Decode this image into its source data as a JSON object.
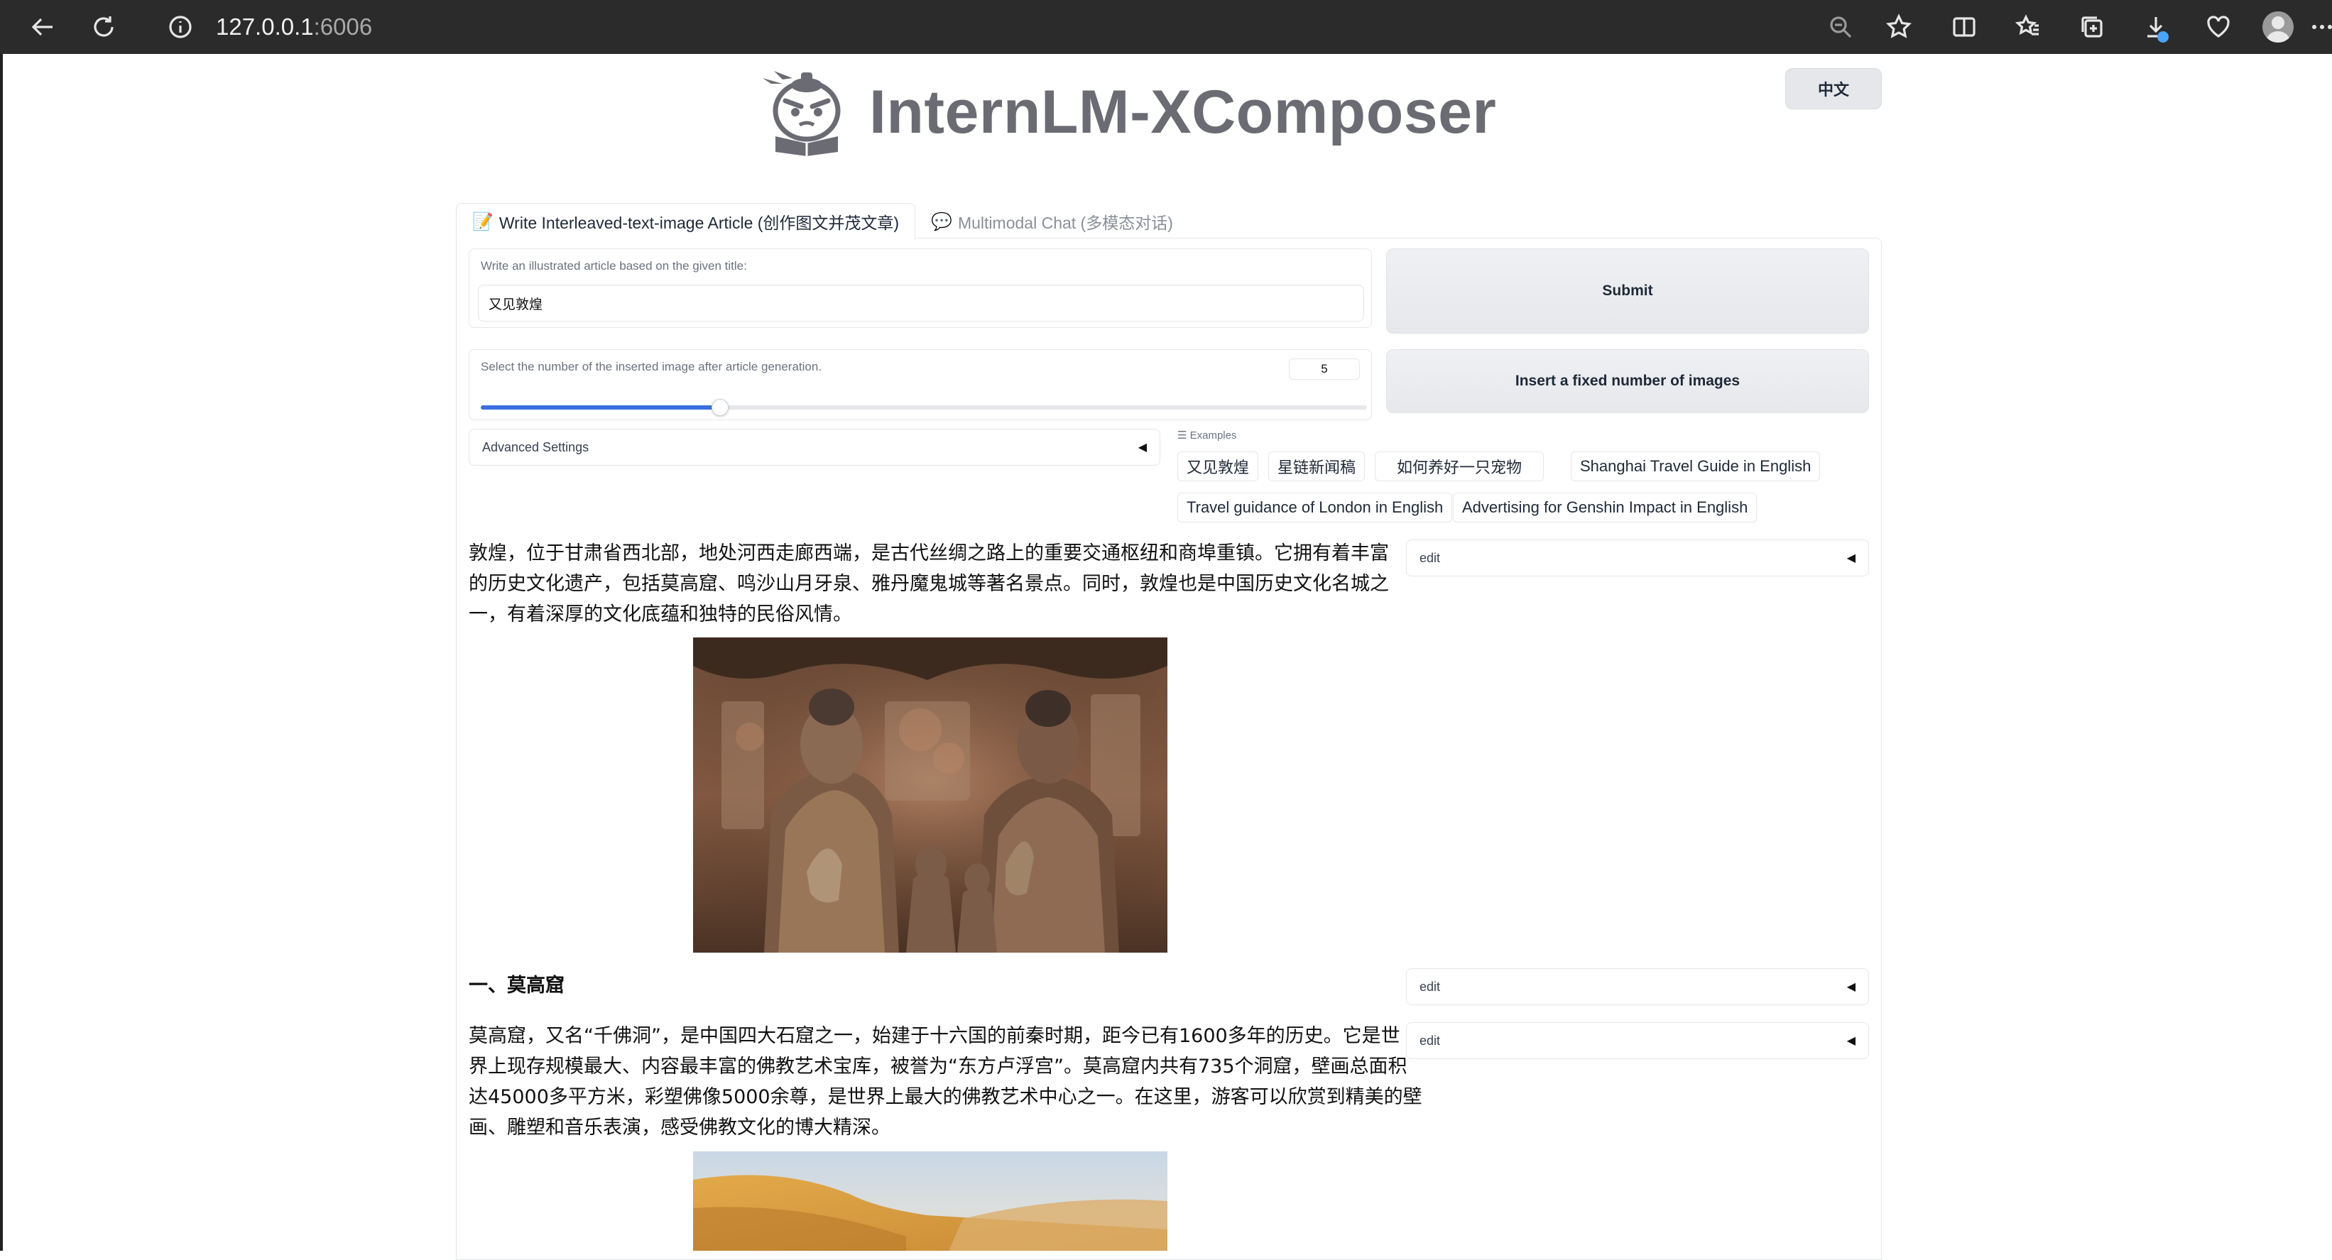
{
  "browser": {
    "url_host": "127.0.0.1",
    "url_port": ":6006"
  },
  "header": {
    "language_button": "中文",
    "app_title": "InternLM-XComposer"
  },
  "tabs": [
    {
      "emoji": "📝",
      "label": "Write Interleaved-text-image Article (创作图文并茂文章)"
    },
    {
      "emoji": "💬",
      "label": "Multimodal Chat (多模态对话)"
    }
  ],
  "form": {
    "title_label": "Write an illustrated article based on the given title:",
    "title_value": "又见敦煌",
    "image_count_label": "Select the number of the inserted image after article generation.",
    "image_count_value": "5",
    "image_count_fraction": 0.27,
    "advanced_settings_label": "Advanced Settings",
    "submit_label": "Submit",
    "insert_label": "Insert a fixed number of images"
  },
  "examples": {
    "label": "Examples",
    "items": [
      "又见敦煌",
      "星链新闻稿",
      "如何养好一只宠物",
      "Shanghai Travel Guide in English",
      "Travel guidance of London in English",
      "Advertising for Genshin Impact in English"
    ]
  },
  "article": {
    "paragraph1": [
      "敦煌，位于甘肃省西北部，地处河西走廊西端，是古代丝绸之路上的重要交通枢纽和商埠重镇。它拥有着丰富",
      "的历史文化遗产，包括莫高窟、鸣沙山月牙泉、雅丹魔鬼城等著名景点。同时，敦煌也是中国历史文化名城之",
      "一，有着深厚的文化底蕴和独特的民俗风情。"
    ],
    "heading1": "一、莫高窟",
    "paragraph2": [
      "莫高窟，又名“千佛洞”，是中国四大石窟之一，始建于十六国的前秦时期，距今已有1600多年的历史。它是世",
      "界上现存规模最大、内容最丰富的佛教艺术宝库，被誉为“东方卢浮宫”。莫高窟内共有735个洞窟，壁画总面积",
      "达45000多平方米，彩塑佛像5000余尊，是世界上最大的佛教艺术中心之一。在这里，游客可以欣赏到精美的壁",
      "画、雕塑和音乐表演，感受佛教文化的博大精深。"
    ],
    "edit_label": "edit"
  }
}
